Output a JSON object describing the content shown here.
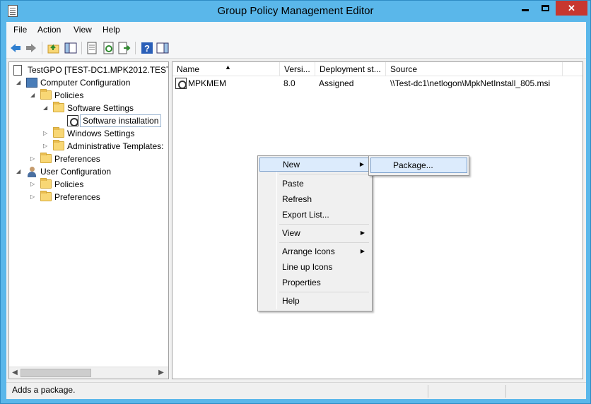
{
  "window": {
    "title": "Group Policy Management Editor",
    "close_glyph": "✕"
  },
  "menu": [
    "File",
    "Action",
    "View",
    "Help"
  ],
  "tree": {
    "root": "TestGPO [TEST-DC1.MPK2012.TEST] P",
    "computer_config": "Computer Configuration",
    "policies": "Policies",
    "software_settings": "Software Settings",
    "software_installation": "Software installation",
    "windows_settings": "Windows Settings",
    "admin_templates": "Administrative Templates:",
    "preferences": "Preferences",
    "user_config": "User Configuration",
    "user_policies": "Policies",
    "user_preferences": "Preferences"
  },
  "columns": [
    "Name",
    "Versi...",
    "Deployment st...",
    "Source"
  ],
  "rows": [
    {
      "name": "MPKMEM",
      "version": "8.0",
      "deployment": "Assigned",
      "source": "\\\\Test-dc1\\netlogon\\MpkNetInstall_805.msi"
    }
  ],
  "context_menu": {
    "new": "New",
    "paste": "Paste",
    "refresh": "Refresh",
    "export": "Export List...",
    "view": "View",
    "arrange": "Arrange Icons",
    "lineup": "Line up Icons",
    "properties": "Properties",
    "help": "Help"
  },
  "submenu": {
    "package": "Package..."
  },
  "status": {
    "text": "Adds a package."
  },
  "colors": {
    "titlebar": "#5ab7ea",
    "close": "#c7372f",
    "highlight": "#dcebfc"
  }
}
